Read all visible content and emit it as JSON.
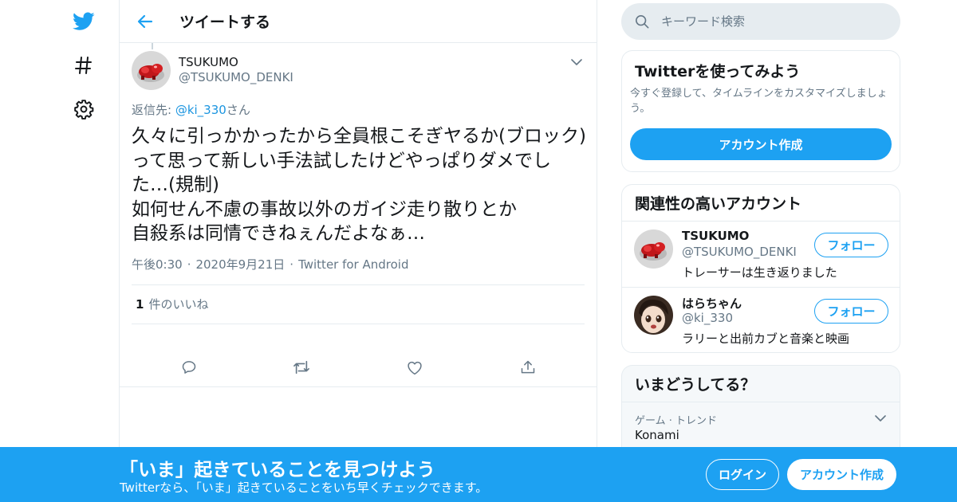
{
  "colors": {
    "brand": "#1da1f2",
    "border": "#e6ecf0",
    "secondary_text": "#657786",
    "link": "#1b95e0"
  },
  "nav": {
    "icons": [
      "twitter-logo-icon",
      "hashtag-icon",
      "settings-gear-icon"
    ]
  },
  "header": {
    "title": "ツイートする"
  },
  "tweet": {
    "author_name": "TSUKUMO",
    "author_handle": "@TSUKUMO_DENKI",
    "reply_prefix": "返信先: ",
    "reply_mention": "@ki_330",
    "reply_suffix": "さん",
    "text": "久々に引っかかったから全員根こそぎヤるか(ブロック)\nって思って新しい手法試したけどやっぱりダメでした…(規制)\n如何せん不慮の事故以外のガイジ走り散りとか\n自殺系は同情できねぇんだよなぁ…",
    "time": "午後0:30",
    "separator": "·",
    "date": "2020年9月21日",
    "source": "Twitter for Android",
    "like_count": "1",
    "like_label": "件のいいね",
    "actions": [
      "reply-icon",
      "retweet-icon",
      "like-icon",
      "share-icon"
    ]
  },
  "search": {
    "placeholder": "キーワード検索"
  },
  "signup_card": {
    "title": "Twitterを使ってみよう",
    "description": "今すぐ登録して、タイムラインをカスタマイズしましょう。",
    "button": "アカウント作成"
  },
  "related": {
    "title": "関連性の高いアカウント",
    "accounts": [
      {
        "name": "TSUKUMO",
        "handle": "@TSUKUMO_DENKI",
        "bio": "トレーサーは生き返りました",
        "follow": "フォロー"
      },
      {
        "name": "はらちゃん",
        "handle": "@ki_330",
        "bio": "ラリーと出前カブと音楽と映画",
        "follow": "フォロー"
      }
    ]
  },
  "trends": {
    "title": "いまどうしてる？",
    "items": [
      {
        "category": "ゲーム · トレンド",
        "name": "Konami"
      }
    ]
  },
  "banner": {
    "title": "「いま」起きていることを見つけよう",
    "subtitle": "Twitterなら、「いま」起きていることをいち早くチェックできます。",
    "login": "ログイン",
    "signup": "アカウント作成"
  }
}
